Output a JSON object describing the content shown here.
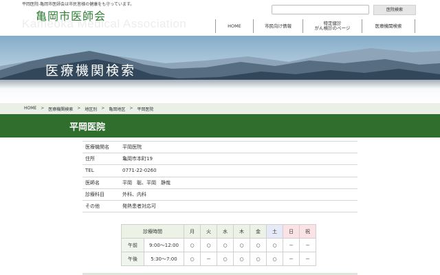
{
  "tagline": "平岡医院-亀岡市医師会は市民皆様の健康をも守っています。",
  "header": {
    "logo": "亀岡市医師会",
    "logo_en": "Kameoka Medical Association",
    "search_button": "医院検索"
  },
  "nav": [
    {
      "label": "HOME"
    },
    {
      "label": "市民向け情報"
    },
    {
      "label_line1": "特定健診",
      "label_line2": "がん検診のページ"
    },
    {
      "label": "医療機関検索"
    }
  ],
  "hero": {
    "title": "医療機関検索"
  },
  "breadcrumb": [
    "HOME",
    "医療機関検索",
    "地区別",
    "亀岡地区",
    "平岡医院"
  ],
  "page_title": "平岡医院",
  "info": [
    {
      "key": "医療機関名",
      "value": "平岡医院"
    },
    {
      "key": "住所",
      "value": "亀岡市本町19"
    },
    {
      "key": "TEL",
      "value": "0771-22-0260"
    },
    {
      "key": "医師名",
      "value": "平岡　聡、平岡　静哉"
    },
    {
      "key": "診療科目",
      "value": "外科、内科"
    },
    {
      "key": "その他",
      "value": "発熱患者対応可"
    }
  ],
  "schedule": {
    "header_label": "診療時間",
    "days": [
      "月",
      "火",
      "水",
      "木",
      "金",
      "土",
      "日",
      "祝"
    ],
    "rows": [
      {
        "label": "午前",
        "time": "9:00〜12:00",
        "marks": [
          "○",
          "○",
          "○",
          "○",
          "○",
          "○",
          "－",
          "－"
        ]
      },
      {
        "label": "午後",
        "time": "5:30〜7:00",
        "marks": [
          "○",
          "－",
          "○",
          "○",
          "○",
          "○",
          "－",
          "－"
        ]
      }
    ]
  },
  "colors": {
    "brand_green": "#2f6e2d",
    "breadcrumb_bg": "#eaf0e6",
    "saturday_bg": "#e6e9f8",
    "sunday_bg": "#fbe3e5"
  }
}
